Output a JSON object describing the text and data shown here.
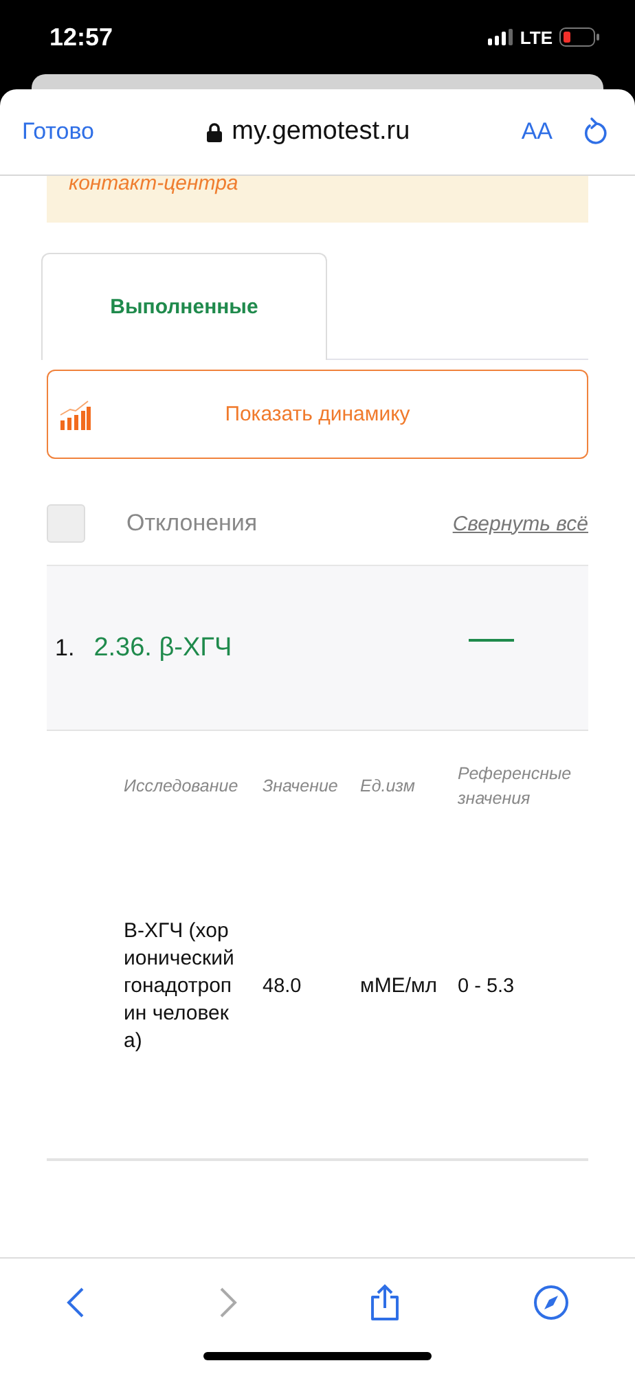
{
  "status_bar": {
    "time": "12:57",
    "network": "LTE"
  },
  "browser": {
    "done": "Готово",
    "url": "my.gemotest.ru",
    "text_size": "AA"
  },
  "notice": {
    "text": "контакт-центра"
  },
  "tabs": [
    {
      "label": "Выполненные",
      "selected": true
    }
  ],
  "dynamics_button": {
    "label": "Показать динамику"
  },
  "filter": {
    "label": "Отклонения",
    "checked": false,
    "collapse_link": "Свернуть всё"
  },
  "sections": [
    {
      "number": "1.",
      "title": "2.36. β-ХГЧ",
      "expanded": true,
      "columns": [
        "Исследование",
        "Значение",
        "Ед.изм",
        "Референсные значения"
      ],
      "rows": [
        {
          "name": "В-ХГЧ (хорионический гонадотропин человека)",
          "value": "48.0",
          "unit": "мМЕ/мл",
          "reference": "0 - 5.3"
        }
      ]
    }
  ],
  "toolbar": [
    {
      "kind": "back",
      "disabled": false
    },
    {
      "kind": "forward",
      "disabled": true
    },
    {
      "kind": "share",
      "disabled": false
    },
    {
      "kind": "compass",
      "disabled": false
    }
  ]
}
